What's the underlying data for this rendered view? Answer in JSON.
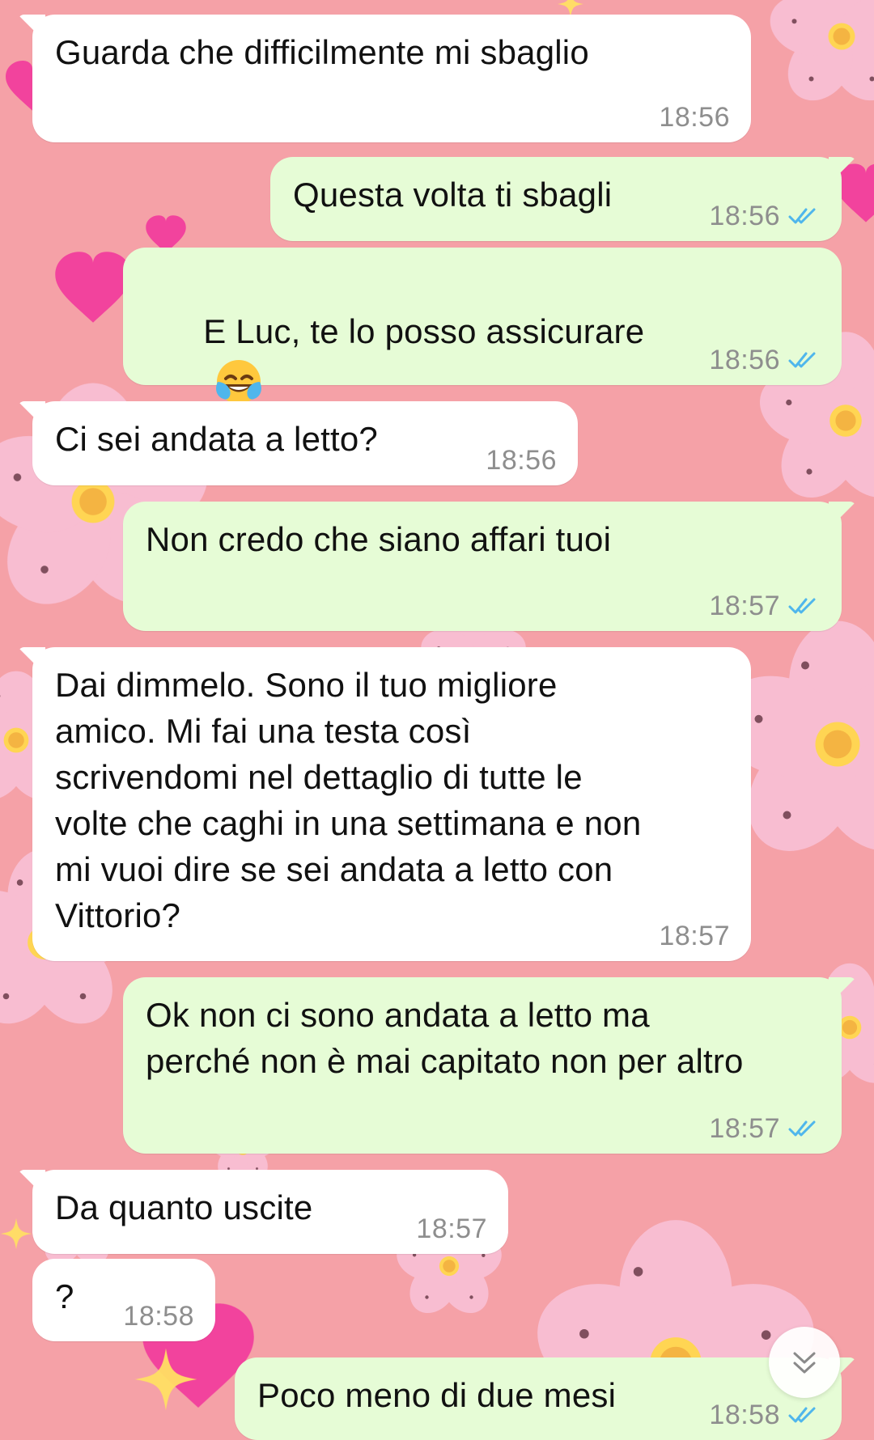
{
  "colors": {
    "background": "#f5a1a7",
    "incoming_bubble": "#ffffff",
    "outgoing_bubble": "#e6fcd6",
    "timestamp": "#8e8e8e",
    "read_receipt": "#4fb6ec"
  },
  "messages": [
    {
      "direction": "incoming",
      "text": "Guarda che difficilmente mi sbaglio",
      "time": "18:56"
    },
    {
      "direction": "outgoing",
      "text": "Questa volta ti sbagli",
      "time": "18:56",
      "status_icon": "double-check-read-icon"
    },
    {
      "direction": "outgoing",
      "text": "E Luc, te lo posso assicurare",
      "emoji": "joy-emoji-icon",
      "time": "18:56",
      "status_icon": "double-check-read-icon"
    },
    {
      "direction": "incoming",
      "text": "Ci sei andata a letto?",
      "time": "18:56"
    },
    {
      "direction": "outgoing",
      "text": "Non credo che siano affari tuoi",
      "time": "18:57",
      "status_icon": "double-check-read-icon"
    },
    {
      "direction": "incoming",
      "text": "Dai dimmelo. Sono il tuo migliore amico. Mi fai una testa così scrivendomi nel dettaglio di tutte le volte che caghi in una settimana e non mi vuoi dire se sei andata a letto con Vittorio?",
      "time": "18:57"
    },
    {
      "direction": "outgoing",
      "text": "Ok non ci sono andata a letto ma perché non è mai capitato non per altro",
      "time": "18:57",
      "status_icon": "double-check-read-icon"
    },
    {
      "direction": "incoming",
      "text": "Da quanto uscite",
      "time": "18:57"
    },
    {
      "direction": "incoming",
      "text": "?",
      "time": "18:58"
    },
    {
      "direction": "outgoing",
      "text": "Poco meno di due mesi",
      "time": "18:58",
      "status_icon": "double-check-read-icon"
    }
  ],
  "controls": {
    "scroll_to_bottom_icon": "chevron-double-down-icon"
  }
}
